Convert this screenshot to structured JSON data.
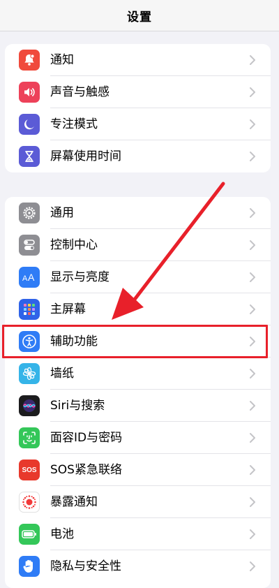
{
  "header": {
    "title": "设置"
  },
  "groups": [
    {
      "items": [
        {
          "label": "通知",
          "icon": "bell-icon",
          "color": "#f04a3c"
        },
        {
          "label": "声音与触感",
          "icon": "speaker-icon",
          "color": "#ed4159"
        },
        {
          "label": "专注模式",
          "icon": "moon-icon",
          "color": "#5b5bd6"
        },
        {
          "label": "屏幕使用时间",
          "icon": "hourglass-icon",
          "color": "#5b5bd6"
        }
      ]
    },
    {
      "items": [
        {
          "label": "通用",
          "icon": "gear-icon",
          "color": "#8e8e93"
        },
        {
          "label": "控制中心",
          "icon": "toggles-icon",
          "color": "#8e8e93"
        },
        {
          "label": "显示与亮度",
          "icon": "text-size-icon",
          "color": "#2f7cf6"
        },
        {
          "label": "主屏幕",
          "icon": "home-grid-icon",
          "color": "#2f63e8"
        },
        {
          "label": "辅助功能",
          "icon": "accessibility-icon",
          "color": "#2f7cf6"
        },
        {
          "label": "墙纸",
          "icon": "flower-icon",
          "color": "#35b4e8"
        },
        {
          "label": "Siri与搜索",
          "icon": "siri-icon",
          "color": "#1c1c1e"
        },
        {
          "label": "面容ID与密码",
          "icon": "face-id-icon",
          "color": "#34c759"
        },
        {
          "label": "SOS紧急联络",
          "icon": "sos-icon",
          "color": "#e8392c"
        },
        {
          "label": "暴露通知",
          "icon": "exposure-icon",
          "color": "#ffffff"
        },
        {
          "label": "电池",
          "icon": "battery-icon",
          "color": "#34c759"
        },
        {
          "label": "隐私与安全性",
          "icon": "hand-icon",
          "color": "#2f7cf6"
        }
      ]
    }
  ],
  "sos_text": "SOS",
  "annotation": {
    "color": "#e8202a",
    "highlighted": "辅助功能"
  }
}
